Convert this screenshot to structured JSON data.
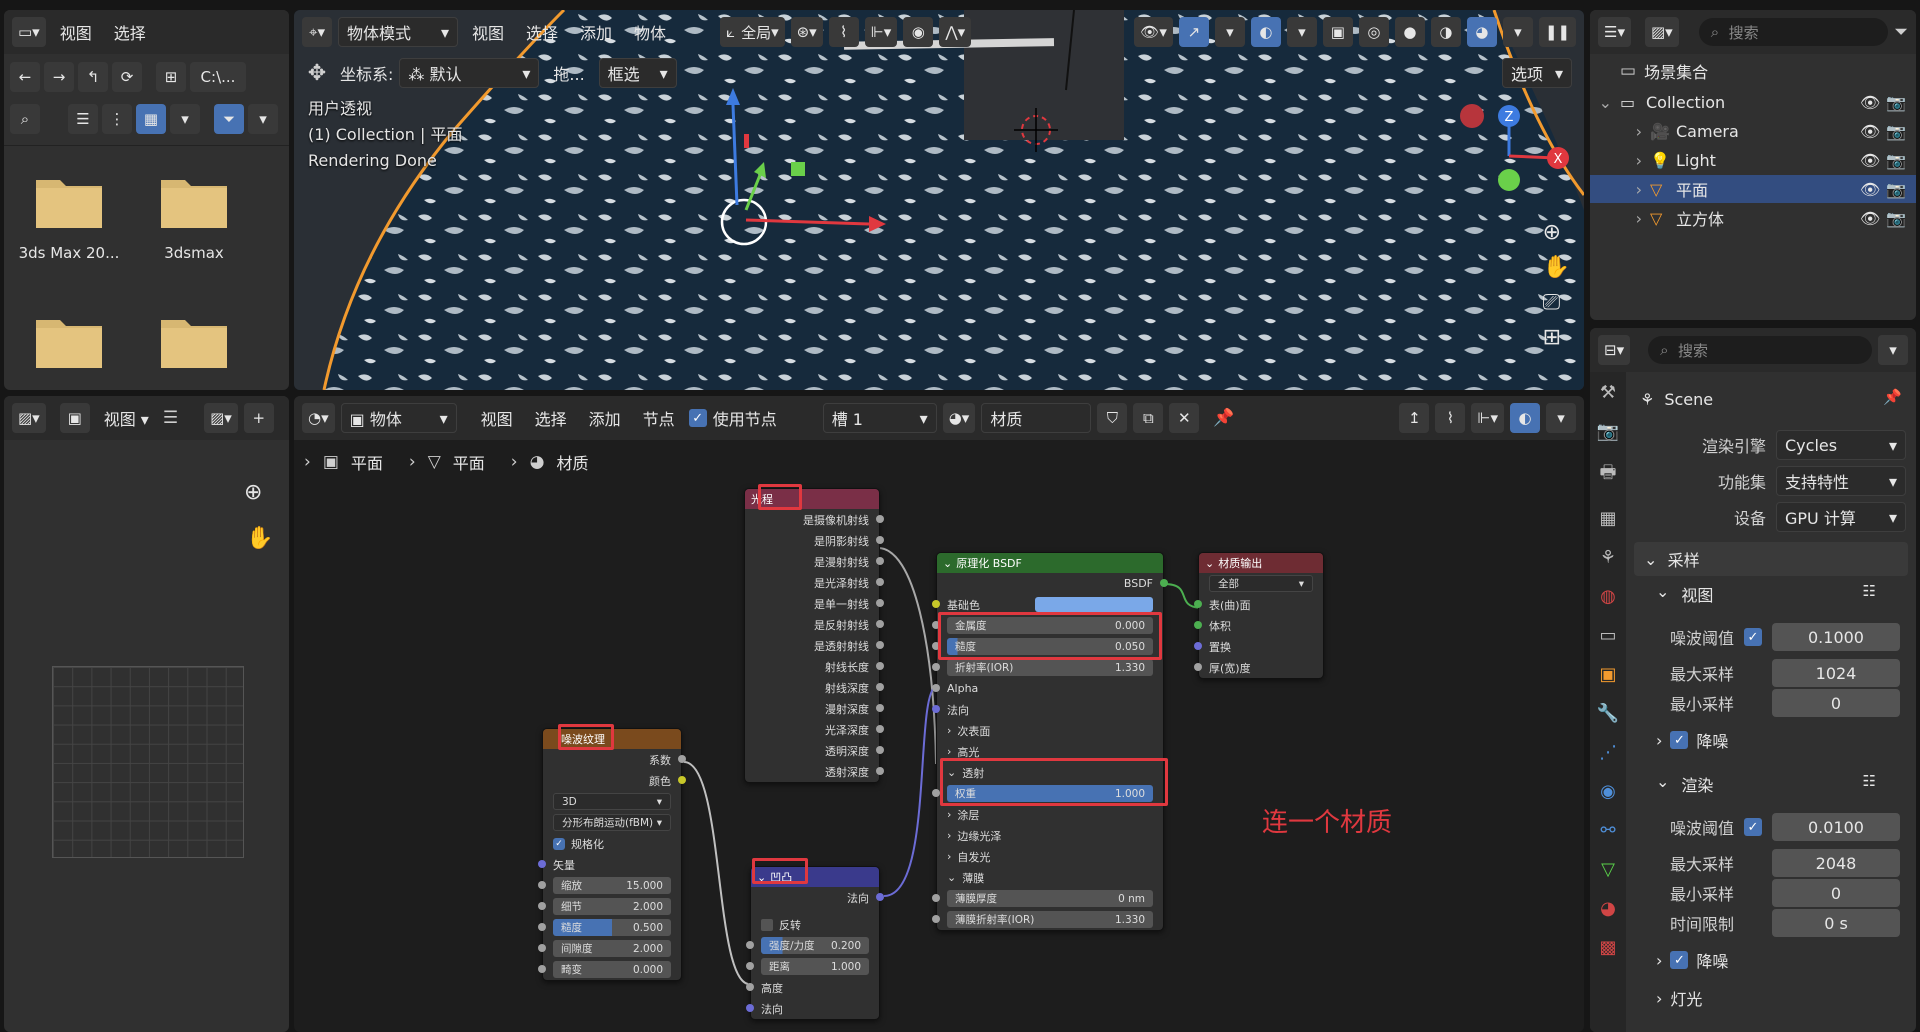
{
  "file_browser": {
    "menu": [
      "视图",
      "选择"
    ],
    "path": "C:\\...",
    "folders": [
      "3ds Max 20...",
      "3dsmax",
      "",
      ""
    ]
  },
  "viewport": {
    "mode": "物体模式",
    "menu": [
      "视图",
      "选择",
      "添加",
      "物体"
    ],
    "transform": "全局",
    "coord_label": "坐标系:",
    "coord_value": "默认",
    "drag_label": "拖...",
    "select_box": "框选",
    "options": "选项",
    "overlay": [
      "用户透视",
      "(1) Collection | 平面",
      "Rendering Done"
    ],
    "gizmo": {
      "z": "Z",
      "x": "X"
    }
  },
  "image_editor": {
    "view": "视图"
  },
  "node_editor": {
    "mode": "物体",
    "menu": [
      "视图",
      "选择",
      "添加",
      "节点"
    ],
    "use_nodes": "使用节点",
    "slot": "槽 1",
    "material": "材质",
    "breadcrumb": [
      "平面",
      "平面",
      "材质"
    ],
    "annotation": "连一个材质",
    "light_path": {
      "title": "光程",
      "outputs": [
        "是摄像机射线",
        "是阴影射线",
        "是漫射射线",
        "是光泽射线",
        "是单一射线",
        "是反射射线",
        "是透射射线",
        "射线长度",
        "射线深度",
        "漫射深度",
        "光泽深度",
        "透明深度",
        "透射深度"
      ]
    },
    "bsdf": {
      "title": "原理化 BSDF",
      "out": "BSDF",
      "base_color": "基础色",
      "metallic": {
        "label": "金属度",
        "value": "0.000"
      },
      "roughness": {
        "label": "糙度",
        "value": "0.050"
      },
      "ior": {
        "label": "折射率(IOR)",
        "value": "1.330"
      },
      "alpha": "Alpha",
      "normal": "法向",
      "subsurface": "次表面",
      "specular": "高光",
      "transmission": "透射",
      "weight": {
        "label": "权重",
        "value": "1.000"
      },
      "coat": "涂层",
      "sheen": "边缘光泽",
      "emission": "自发光",
      "thin_film": "薄膜",
      "film_thickness": {
        "label": "薄膜厚度",
        "value": "0 nm"
      },
      "film_ior": {
        "label": "薄膜折射率(IOR)",
        "value": "1.330"
      }
    },
    "output": {
      "title": "材质输出",
      "target": "全部",
      "inputs": [
        "表(曲)面",
        "体积",
        "置换",
        "厚(宽)度"
      ]
    },
    "noise": {
      "title": "噪波纹理",
      "outputs": [
        "系数",
        "颜色"
      ],
      "dim": "3D",
      "type": "分形布朗运动(fBM)",
      "normalize": "规格化",
      "vector": "矢量",
      "fields": [
        {
          "label": "缩放",
          "value": "15.000"
        },
        {
          "label": "细节",
          "value": "2.000"
        },
        {
          "label": "糙度",
          "value": "0.500"
        },
        {
          "label": "间隙度",
          "value": "2.000"
        },
        {
          "label": "畸变",
          "value": "0.000"
        }
      ]
    },
    "bump": {
      "title": "凹凸",
      "out": "法向",
      "invert": "反转",
      "strength": {
        "label": "强度/力度",
        "value": "0.200"
      },
      "distance": {
        "label": "距离",
        "value": "1.000"
      },
      "height": "高度",
      "normal": "法向"
    }
  },
  "outliner": {
    "search": "搜索",
    "scene_collection": "场景集合",
    "items": [
      "Collection",
      "Camera",
      "Light",
      "平面",
      "立方体"
    ]
  },
  "properties": {
    "search": "搜索",
    "scene": "Scene",
    "engine": {
      "label": "渲染引擎",
      "value": "Cycles"
    },
    "feature": {
      "label": "功能集",
      "value": "支持特性"
    },
    "device": {
      "label": "设备",
      "value": "GPU 计算"
    },
    "sampling": "采样",
    "viewport_sec": "视图",
    "vp_noise": {
      "label": "噪波阈值",
      "value": "0.1000"
    },
    "vp_max": {
      "label": "最大采样",
      "value": "1024"
    },
    "vp_min": {
      "label": "最小采样",
      "value": "0"
    },
    "denoise": "降噪",
    "render_sec": "渲染",
    "r_noise": {
      "label": "噪波阈值",
      "value": "0.0100"
    },
    "r_max": {
      "label": "最大采样",
      "value": "2048"
    },
    "r_min": {
      "label": "最小采样",
      "value": "0"
    },
    "r_time": {
      "label": "时间限制",
      "value": "0 s"
    },
    "lights": "灯光"
  },
  "colors": {
    "accent": "#4772b3",
    "highlight": "#e0383f",
    "orange": "#f29a2e"
  }
}
